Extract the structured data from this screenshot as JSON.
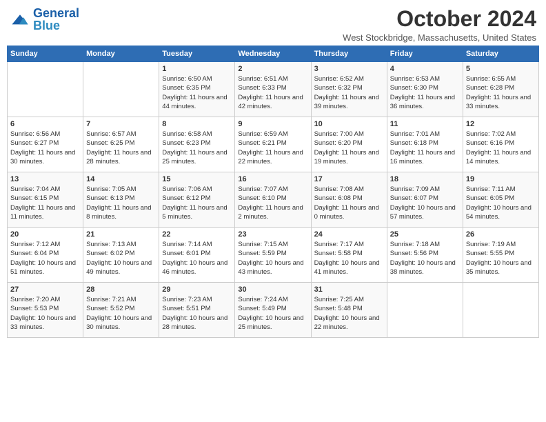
{
  "header": {
    "logo_line1": "General",
    "logo_line2": "Blue",
    "month": "October 2024",
    "location": "West Stockbridge, Massachusetts, United States"
  },
  "days_of_week": [
    "Sunday",
    "Monday",
    "Tuesday",
    "Wednesday",
    "Thursday",
    "Friday",
    "Saturday"
  ],
  "weeks": [
    [
      {
        "day": "",
        "info": ""
      },
      {
        "day": "",
        "info": ""
      },
      {
        "day": "1",
        "info": "Sunrise: 6:50 AM\nSunset: 6:35 PM\nDaylight: 11 hours and 44 minutes."
      },
      {
        "day": "2",
        "info": "Sunrise: 6:51 AM\nSunset: 6:33 PM\nDaylight: 11 hours and 42 minutes."
      },
      {
        "day": "3",
        "info": "Sunrise: 6:52 AM\nSunset: 6:32 PM\nDaylight: 11 hours and 39 minutes."
      },
      {
        "day": "4",
        "info": "Sunrise: 6:53 AM\nSunset: 6:30 PM\nDaylight: 11 hours and 36 minutes."
      },
      {
        "day": "5",
        "info": "Sunrise: 6:55 AM\nSunset: 6:28 PM\nDaylight: 11 hours and 33 minutes."
      }
    ],
    [
      {
        "day": "6",
        "info": "Sunrise: 6:56 AM\nSunset: 6:27 PM\nDaylight: 11 hours and 30 minutes."
      },
      {
        "day": "7",
        "info": "Sunrise: 6:57 AM\nSunset: 6:25 PM\nDaylight: 11 hours and 28 minutes."
      },
      {
        "day": "8",
        "info": "Sunrise: 6:58 AM\nSunset: 6:23 PM\nDaylight: 11 hours and 25 minutes."
      },
      {
        "day": "9",
        "info": "Sunrise: 6:59 AM\nSunset: 6:21 PM\nDaylight: 11 hours and 22 minutes."
      },
      {
        "day": "10",
        "info": "Sunrise: 7:00 AM\nSunset: 6:20 PM\nDaylight: 11 hours and 19 minutes."
      },
      {
        "day": "11",
        "info": "Sunrise: 7:01 AM\nSunset: 6:18 PM\nDaylight: 11 hours and 16 minutes."
      },
      {
        "day": "12",
        "info": "Sunrise: 7:02 AM\nSunset: 6:16 PM\nDaylight: 11 hours and 14 minutes."
      }
    ],
    [
      {
        "day": "13",
        "info": "Sunrise: 7:04 AM\nSunset: 6:15 PM\nDaylight: 11 hours and 11 minutes."
      },
      {
        "day": "14",
        "info": "Sunrise: 7:05 AM\nSunset: 6:13 PM\nDaylight: 11 hours and 8 minutes."
      },
      {
        "day": "15",
        "info": "Sunrise: 7:06 AM\nSunset: 6:12 PM\nDaylight: 11 hours and 5 minutes."
      },
      {
        "day": "16",
        "info": "Sunrise: 7:07 AM\nSunset: 6:10 PM\nDaylight: 11 hours and 2 minutes."
      },
      {
        "day": "17",
        "info": "Sunrise: 7:08 AM\nSunset: 6:08 PM\nDaylight: 11 hours and 0 minutes."
      },
      {
        "day": "18",
        "info": "Sunrise: 7:09 AM\nSunset: 6:07 PM\nDaylight: 10 hours and 57 minutes."
      },
      {
        "day": "19",
        "info": "Sunrise: 7:11 AM\nSunset: 6:05 PM\nDaylight: 10 hours and 54 minutes."
      }
    ],
    [
      {
        "day": "20",
        "info": "Sunrise: 7:12 AM\nSunset: 6:04 PM\nDaylight: 10 hours and 51 minutes."
      },
      {
        "day": "21",
        "info": "Sunrise: 7:13 AM\nSunset: 6:02 PM\nDaylight: 10 hours and 49 minutes."
      },
      {
        "day": "22",
        "info": "Sunrise: 7:14 AM\nSunset: 6:01 PM\nDaylight: 10 hours and 46 minutes."
      },
      {
        "day": "23",
        "info": "Sunrise: 7:15 AM\nSunset: 5:59 PM\nDaylight: 10 hours and 43 minutes."
      },
      {
        "day": "24",
        "info": "Sunrise: 7:17 AM\nSunset: 5:58 PM\nDaylight: 10 hours and 41 minutes."
      },
      {
        "day": "25",
        "info": "Sunrise: 7:18 AM\nSunset: 5:56 PM\nDaylight: 10 hours and 38 minutes."
      },
      {
        "day": "26",
        "info": "Sunrise: 7:19 AM\nSunset: 5:55 PM\nDaylight: 10 hours and 35 minutes."
      }
    ],
    [
      {
        "day": "27",
        "info": "Sunrise: 7:20 AM\nSunset: 5:53 PM\nDaylight: 10 hours and 33 minutes."
      },
      {
        "day": "28",
        "info": "Sunrise: 7:21 AM\nSunset: 5:52 PM\nDaylight: 10 hours and 30 minutes."
      },
      {
        "day": "29",
        "info": "Sunrise: 7:23 AM\nSunset: 5:51 PM\nDaylight: 10 hours and 28 minutes."
      },
      {
        "day": "30",
        "info": "Sunrise: 7:24 AM\nSunset: 5:49 PM\nDaylight: 10 hours and 25 minutes."
      },
      {
        "day": "31",
        "info": "Sunrise: 7:25 AM\nSunset: 5:48 PM\nDaylight: 10 hours and 22 minutes."
      },
      {
        "day": "",
        "info": ""
      },
      {
        "day": "",
        "info": ""
      }
    ]
  ]
}
